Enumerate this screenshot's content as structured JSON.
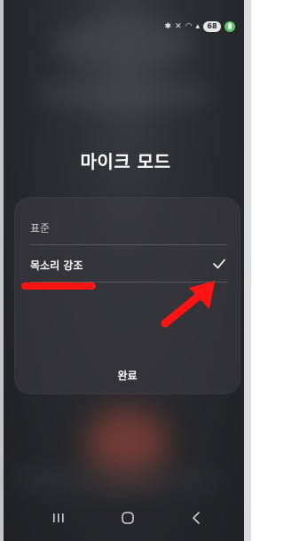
{
  "status_bar": {
    "icons": [
      "bluetooth-icon",
      "mute-icon",
      "wifi-icon",
      "signal-icon"
    ],
    "battery_level": "68",
    "mic_active_color": "#59c76a"
  },
  "dialog": {
    "title": "마이크 모드",
    "options": [
      {
        "label": "표준",
        "selected": false
      },
      {
        "label": "목소리 강조",
        "selected": true
      }
    ],
    "done_label": "완료"
  },
  "annotations": {
    "highlight_color": "#ff1414"
  },
  "nav_bar": {
    "buttons": [
      "recent-apps-icon",
      "home-icon",
      "back-icon"
    ]
  }
}
